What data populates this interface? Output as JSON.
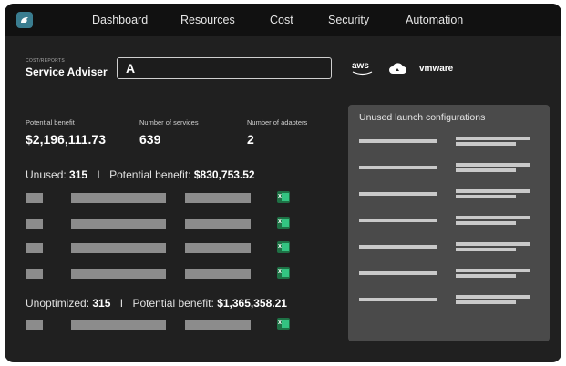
{
  "nav": {
    "items": [
      "Dashboard",
      "Resources",
      "Cost",
      "Security",
      "Automation"
    ]
  },
  "header": {
    "breadcrumb": "COST/REPORTS",
    "title": "Service Adviser",
    "search_icon": "A"
  },
  "providers": [
    "aws",
    "cloud",
    "vmware"
  ],
  "stats": [
    {
      "label": "Potential benefit",
      "value": "$2,196,111.73"
    },
    {
      "label": "Number of services",
      "value": "639"
    },
    {
      "label": "Number of adapters",
      "value": "2"
    }
  ],
  "groups": [
    {
      "prefix": "Unused:",
      "count": "315",
      "sep": "I",
      "benefit_label": "Potential benefit:",
      "benefit": "$830,753.52",
      "rows": 4
    },
    {
      "prefix": "Unoptimized:",
      "count": "315",
      "sep": "I",
      "benefit_label": "Potential benefit:",
      "benefit": "$1,365,358.21",
      "rows": 1
    }
  ],
  "panel": {
    "title": "Unused launch configurations",
    "rows": 7
  },
  "colors": {
    "background": "#202020",
    "nav": "#111111",
    "panel": "#4a4a4a",
    "excel": "#1e7145",
    "logo": "#3a7d90"
  }
}
